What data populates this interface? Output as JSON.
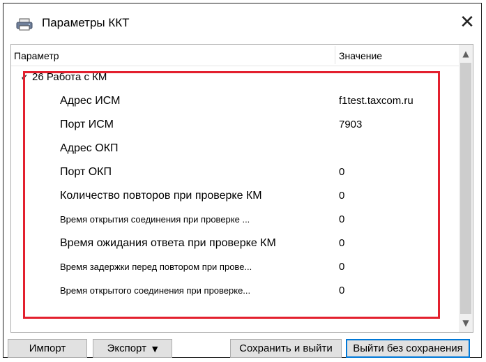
{
  "window": {
    "title": "Параметры ККТ",
    "close_glyph": "✕"
  },
  "table": {
    "columns": {
      "parameter": "Параметр",
      "value": "Значение"
    },
    "group": {
      "label": "26 Работа с КМ",
      "arrow_glyph": "✔"
    },
    "rows": [
      {
        "name": "Адрес ИСМ",
        "value": "f1test.taxcom.ru"
      },
      {
        "name": "Порт ИСМ",
        "value": "7903"
      },
      {
        "name": "Адрес ОКП",
        "value": ""
      },
      {
        "name": "Порт ОКП",
        "value": "0"
      },
      {
        "name": "Количество повторов при проверке КМ",
        "value": "0"
      },
      {
        "name": "Время открытия соединения при проверке ...",
        "value": "0"
      },
      {
        "name": "Время ожидания ответа при проверке КМ",
        "value": "0"
      },
      {
        "name": "Время задержки перед повтором при прове...",
        "value": "0"
      },
      {
        "name": "Время открытого соединения при проверке...",
        "value": "0"
      }
    ]
  },
  "scrollbar": {
    "up_glyph": "▲",
    "down_glyph": "▼"
  },
  "buttons": {
    "import": "Импорт",
    "export": "Экспорт",
    "export_caret": "▼",
    "save_exit": "Сохранить и выйти",
    "exit_no_save": "Выйти без сохранения"
  },
  "colors": {
    "highlight": "#e3202e",
    "accent": "#0078d7"
  },
  "icons": {
    "title": "printer-icon",
    "close": "close-icon",
    "expand": "chevron-down-icon"
  }
}
